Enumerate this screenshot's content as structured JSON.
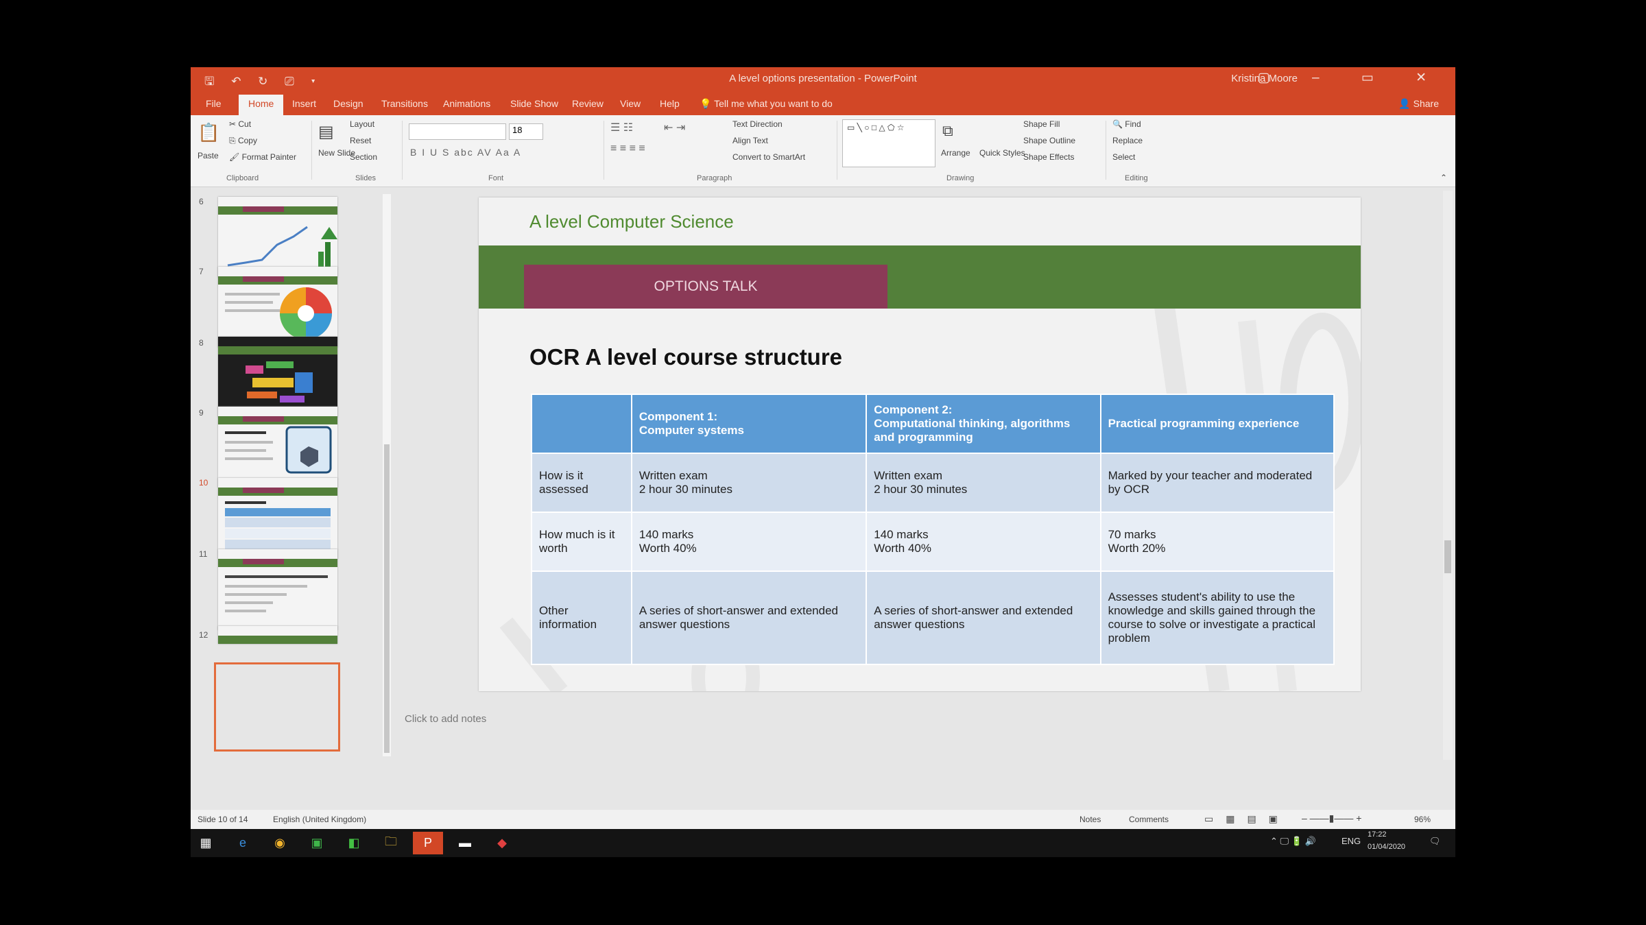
{
  "window": {
    "title": "A level options presentation - PowerPoint",
    "user": "Kristina Moore",
    "quick_access": "🖫 ↶ ↻ ⎚ ▾",
    "controls": "▢ – ▭ ✕"
  },
  "ribbon_tabs": [
    "File",
    "Home",
    "Insert",
    "Design",
    "Transitions",
    "Animations",
    "Slide Show",
    "Review",
    "View",
    "Help"
  ],
  "active_tab": "Home",
  "tell_me": "Tell me what you want to do",
  "share": "Share",
  "ribbon": {
    "clipboard": {
      "paste": "Paste",
      "cut": "Cut",
      "copy": "Copy",
      "format_painter": "Format Painter",
      "label": "Clipboard"
    },
    "slides": {
      "new_slide": "New Slide",
      "layout": "Layout",
      "reset": "Reset",
      "section": "Section",
      "label": "Slides"
    },
    "font": {
      "font_name": "",
      "font_size": "18",
      "label": "Font",
      "format_row": "B  I  U  S  abc  AV  Aa  A"
    },
    "paragraph": {
      "text_direction": "Text Direction",
      "align_text": "Align Text",
      "smartart": "Convert to SmartArt",
      "label": "Paragraph"
    },
    "drawing": {
      "shapes_preview": "▭ ╲ ○ □ △ ⬠ ☆",
      "arrange": "Arrange",
      "quick_styles": "Quick Styles",
      "shape_fill": "Shape Fill",
      "shape_outline": "Shape Outline",
      "shape_effects": "Shape Effects",
      "label": "Drawing"
    },
    "editing": {
      "find": "Find",
      "replace": "Replace",
      "select": "Select",
      "label": "Editing"
    }
  },
  "thumbnails": [
    {
      "number": "6",
      "kind": "line-chart"
    },
    {
      "number": "7",
      "kind": "pie"
    },
    {
      "number": "8",
      "kind": "wordcloud"
    },
    {
      "number": "9",
      "kind": "monitor"
    },
    {
      "number": "10",
      "kind": "table",
      "selected": true
    },
    {
      "number": "11",
      "kind": "text"
    },
    {
      "number": "12",
      "kind": "partial"
    }
  ],
  "slide": {
    "subtitle": "A level Computer Science",
    "tag": "OPTIONS TALK",
    "heading": "OCR A level course structure",
    "table": {
      "headers": [
        "",
        "Component 1:\nComputer systems",
        "Component 2:\nComputational thinking, algorithms and programming",
        "Practical programming experience"
      ],
      "rows": [
        [
          "How is it assessed",
          "Written exam\n2 hour 30 minutes",
          "Written exam\n2 hour 30 minutes",
          "Marked by your teacher and moderated by OCR"
        ],
        [
          "How much is it worth",
          "140 marks\nWorth 40%",
          "140 marks\nWorth 40%",
          "70 marks\nWorth 20%"
        ],
        [
          "Other information",
          "A series of short-answer and extended answer questions",
          "A series of short-answer and extended answer questions",
          "Assesses student's ability to use the knowledge and skills gained through the course to solve or investigate a practical problem"
        ]
      ]
    }
  },
  "notes_placeholder": "Click to add notes",
  "status": {
    "slide_counter": "Slide 10 of 14",
    "language": "English (United Kingdom)",
    "notes": "Notes",
    "comments": "Comments",
    "zoom": "96%"
  },
  "taskbar": {
    "time": "17:22",
    "date": "01/04/2020",
    "lang": "ENG"
  },
  "colors": {
    "powerpoint_orange": "#d24726",
    "slide_green": "#53803a",
    "slide_maroon": "#8b3a57",
    "table_header_blue": "#5b9bd5",
    "table_cell_blue": "#cfdcec"
  }
}
